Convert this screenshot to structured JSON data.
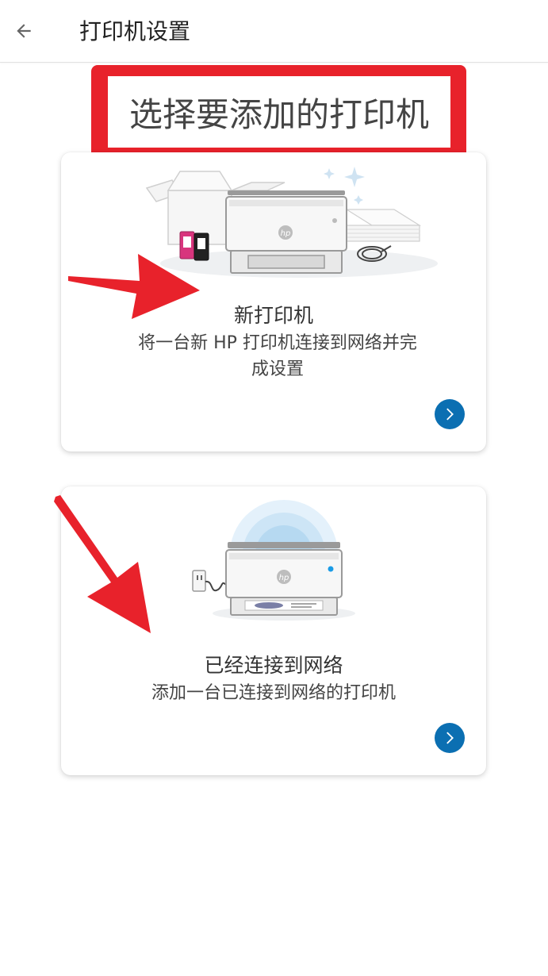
{
  "appbar": {
    "title": "打印机设置",
    "back_icon": "arrow-left-icon"
  },
  "heading": {
    "text": "选择要添加的打印机",
    "highlight_color": "#e8222b"
  },
  "options": [
    {
      "title": "新打印机",
      "description": "将一台新 HP 打印机连接到网络并完成设置",
      "illustration": "printer-unboxing-illustration",
      "logo_text": "hp",
      "action_icon": "chevron-right-icon"
    },
    {
      "title": "已经连接到网络",
      "description": "添加一台已连接到网络的打印机",
      "illustration": "printer-network-illustration",
      "logo_text": "hp",
      "action_icon": "chevron-right-icon"
    }
  ],
  "annotations": {
    "arrow_color": "#e8222b"
  },
  "colors": {
    "accent": "#0b6fb2",
    "annotation": "#e8222b"
  }
}
